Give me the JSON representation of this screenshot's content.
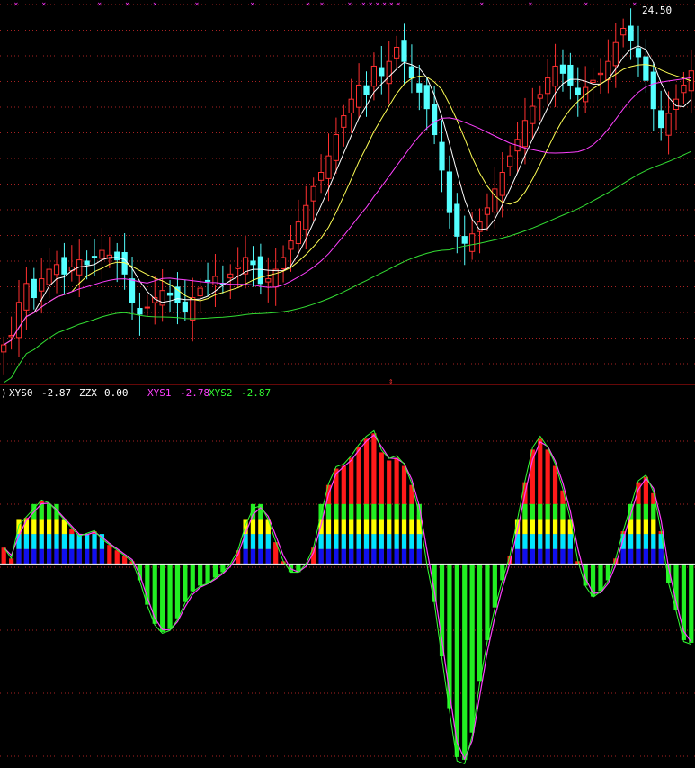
{
  "chart_data": [
    {
      "type": "candlestick",
      "panel": "price",
      "price_label": "24.50",
      "ylim": [
        9,
        25.2
      ],
      "colors": {
        "up": "#ff3030",
        "down": "#54ffff",
        "ma5": "#ffffff",
        "ma10": "#ffff55",
        "ma20": "#ff40ff",
        "ma60": "#33dd33",
        "grid": "#aa2222",
        "marker": "#ff33ff"
      },
      "closes": [
        10.6,
        11.0,
        12.4,
        13.2,
        12.6,
        13.4,
        13.8,
        14.0,
        13.6,
        13.9,
        14.2,
        14.0,
        14.3,
        14.6,
        14.4,
        14.2,
        13.6,
        12.4,
        11.9,
        12.2,
        12.6,
        12.9,
        12.7,
        12.4,
        12.0,
        12.6,
        13.0,
        13.3,
        13.5,
        13.2,
        13.6,
        13.9,
        14.3,
        14.0,
        13.2,
        13.4,
        13.8,
        14.3,
        15.0,
        15.8,
        16.5,
        17.3,
        17.9,
        18.6,
        19.5,
        20.3,
        21.0,
        21.6,
        21.2,
        22.4,
        22.0,
        22.6,
        23.2,
        22.6,
        21.9,
        21.3,
        20.6,
        19.5,
        18.0,
        16.2,
        15.2,
        14.9,
        15.3,
        15.8,
        16.4,
        17.2,
        17.9,
        18.6,
        19.3,
        20.1,
        20.7,
        21.2,
        21.9,
        22.4,
        22.1,
        21.6,
        21.2,
        21.5,
        21.8,
        22.1,
        22.6,
        23.4,
        24.0,
        23.5,
        22.8,
        21.8,
        20.6,
        19.8,
        20.4,
        21.0,
        21.6,
        22.2
      ]
    },
    {
      "type": "bar+line",
      "panel": "indicator",
      "legend": [
        {
          "name": "XYS0",
          "value": "-2.87",
          "color": "#ffffff"
        },
        {
          "name": "ZZX",
          "value": "0.00",
          "color": "#ffffff"
        },
        {
          "name": "XYS1",
          "value": "-2.78",
          "color": "#ff40ff"
        },
        {
          "name": "XYS2",
          "value": "-2.87",
          "color": "#33ff33"
        }
      ],
      "ylim": [
        -7.5,
        6
      ],
      "colors": {
        "pos": "#ff1a1a",
        "neg": "#22ee22",
        "blue": "#1010ee",
        "cyan": "#00e5ff",
        "yellow": "#ffff00",
        "green": "#22ee22",
        "zero": "#ffffff",
        "grid": "#aa2222"
      },
      "values": [
        0.6,
        0.2,
        1.4,
        1.7,
        2.0,
        2.3,
        2.2,
        1.9,
        1.6,
        1.3,
        1.0,
        1.1,
        1.2,
        0.9,
        0.7,
        0.5,
        0.3,
        0.1,
        -0.6,
        -1.5,
        -2.2,
        -2.5,
        -2.4,
        -2.0,
        -1.4,
        -1.0,
        -0.8,
        -0.7,
        -0.5,
        -0.3,
        0.0,
        0.5,
        1.4,
        2.0,
        2.1,
        1.6,
        0.8,
        0.1,
        -0.3,
        -0.3,
        0.0,
        0.6,
        1.8,
        2.9,
        3.5,
        3.6,
        3.9,
        4.3,
        4.6,
        4.8,
        4.1,
        3.8,
        3.9,
        3.6,
        2.9,
        1.8,
        0.0,
        -1.4,
        -3.4,
        -5.3,
        -7.1,
        -7.2,
        -6.2,
        -4.3,
        -2.8,
        -1.6,
        -0.6,
        0.3,
        1.6,
        3.0,
        4.2,
        4.6,
        4.2,
        3.6,
        2.7,
        1.6,
        0.1,
        -0.8,
        -1.2,
        -1.0,
        -0.6,
        0.2,
        1.2,
        2.1,
        3.0,
        3.2,
        2.6,
        1.2,
        -0.7,
        -1.7,
        -2.8,
        -2.9
      ]
    }
  ]
}
